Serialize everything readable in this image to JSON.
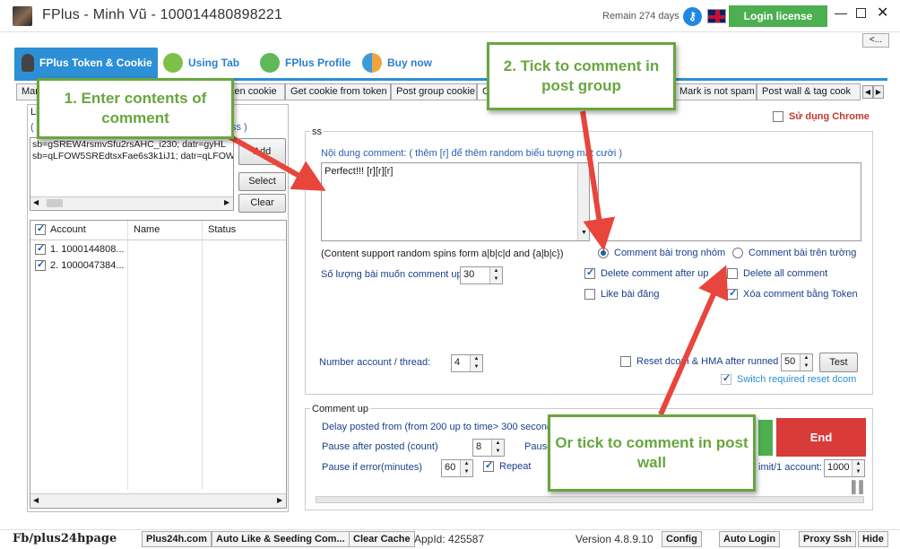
{
  "title_bar": {
    "app_name": "FPlus - Minh Vũ - 100014480898221",
    "remain": "Remain 274 days",
    "login_label": "Login license",
    "back_label": "<..."
  },
  "main_tabs": [
    "FPlus Token & Cookie",
    "Using Tab",
    "FPlus Profile",
    "Buy now"
  ],
  "sub_tabs": [
    "Mar",
    "ken cookie",
    "Get cookie from token",
    "Post group cookie",
    "C",
    "Mark is not spam",
    "Post wall & tag cook"
  ],
  "cookie_panel": {
    "label": "Lis",
    "hint_left": "( C",
    "hint_right": "ss )",
    "lines": [
      "sb=gSREW4rsmvSfu2rsAHC_i230; datr=gyHL",
      "sb=qLFOW5SREdtsxFae6s3k1iJ1; datr=qLFOW"
    ],
    "add_label": "Add",
    "select_label": "Select",
    "clear_label": "Clear"
  },
  "accounts": {
    "columns": [
      "Account",
      "Name",
      "Status"
    ],
    "rows": [
      {
        "account": "1. 1000144808...",
        "name": "",
        "status": ""
      },
      {
        "account": "2. 1000047384...",
        "name": "",
        "status": ""
      }
    ]
  },
  "settings": {
    "group_label": "ss",
    "use_chrome": "Sử dụng Chrome",
    "content_label": "Nội dung comment: ( thêm [r] để thêm random biểu tượng mặt cười )",
    "comment_text": "Perfect!!! [r][r][r]",
    "spin_note": "(Content support random spins form a|b|c|d and {a|b|c})",
    "radio_group": "Comment bài trong nhóm",
    "radio_wall": "Comment bài trên tường",
    "delete_after": "Delete comment after up",
    "delete_all": "Delete all comment",
    "like_post": "Like bài đăng",
    "delete_token": "Xóa comment bằng Token",
    "qty_label": "Số lượng bài muốn comment up",
    "qty_value": "30",
    "thread_label": "Number account / thread:",
    "thread_value": "4",
    "reset_label": "Reset dcom & HMA after runned",
    "reset_value": "50",
    "test_label": "Test",
    "switch_label": "Switch required reset dcom"
  },
  "comment_up": {
    "label": "Comment up",
    "delay": "Delay posted from (from 200 up to time> 300 seconds)",
    "pause_after": "Pause after posted (count)",
    "pause_after_value": "8",
    "pause_short": "Pause",
    "pause_error": "Pause if error(minutes)",
    "pause_error_value": "60",
    "repeat": "Repeat",
    "limit": "imit/1 account:",
    "limit_value": "1000",
    "end_label": "End"
  },
  "callouts": {
    "one": "1. Enter contents of comment",
    "two": "2. Tick to comment in post group",
    "three": "Or tick to comment in post wall"
  },
  "footer": {
    "title": "Fb/plus24hpage",
    "buttons": [
      "Plus24h.com",
      "Auto Like & Seeding Com...",
      "Clear Cache"
    ],
    "appid": "AppId: 425587",
    "version": "Version 4.8.9.10",
    "right_buttons": [
      "Config",
      "Auto Login",
      "Proxy Ssh",
      "Hide"
    ]
  },
  "colors": {
    "accent": "#2d8fd5",
    "callout_green": "#68a63e",
    "arrow_red": "#e8453c",
    "end_red": "#d93a3a",
    "login_green": "#4caf50"
  }
}
